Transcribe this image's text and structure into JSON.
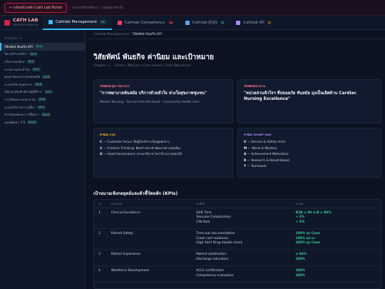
{
  "topbar": {
    "back_label": "← กลับหน้าหลัก Cath Lab Portal",
    "note": "ระบบบริหารจัดการ · แผนกสวนหัวใจ"
  },
  "sidebar": {
    "brand_title": "CATH LAB",
    "brand_sub": "บริหารจัดการคุณภาพ",
    "section_label": "หัวข้อจัดการ",
    "items": [
      {
        "label": "วิสัยทัศน์ พันธกิจ KPI",
        "badge": "Ch.1"
      },
      {
        "label": "โครงสร้างองค์กร",
        "badge": "Ch.2"
      },
      {
        "label": "นโยบายองค์กร",
        "badge": "Ch.3"
      },
      {
        "label": "ระบบงานประจำวัน",
        "badge": "Ch.4"
      },
      {
        "label": "คุณภาพและความปลอดภัย",
        "badge": "Ch.5"
      },
      {
        "label": "ระบบบริหารบุคลากร",
        "badge": "Ch.6"
      },
      {
        "label": "วัสดุ ครุภัณฑ์ ห้องปฏิบัติการ",
        "badge": "Ch.7"
      },
      {
        "label": "การเงินและงบประมาณ",
        "badge": "Ch.8"
      },
      {
        "label": "ระบบบริหารความเสี่ยง",
        "badge": "Ch.9"
      },
      {
        "label": "สารสนเทศและการสื่อสาร",
        "badge": "Ch.10"
      },
      {
        "label": "แผนพัฒนา 3 ปี",
        "badge": "Ch.11"
      }
    ]
  },
  "tabs": [
    {
      "label": "Cathlab Management",
      "badge": "11",
      "icon": "clipboard-icon",
      "color": "#38bdf8"
    },
    {
      "label": "Cathlab Competency",
      "badge": "18",
      "icon": "target-icon",
      "color": "#f43f5e"
    },
    {
      "label": "Cathlab JD/JS",
      "badge": "4",
      "icon": "person-icon",
      "color": "#60a5fa"
    },
    {
      "label": "Cathlab WI",
      "badge": "8",
      "icon": "gear-icon",
      "color": "#a78bfa"
    }
  ],
  "breadcrumb": {
    "root": "Cathlab Management /",
    "current": "วิสัยทัศน์ พันธกิจ KPI"
  },
  "page": {
    "title": "วิสัยทัศน์ พันธกิจ ค่านิยม และเป้าหมาย",
    "subtitle": "Chapter 1 — Vision | Mission | Core Values | Unit Objectives"
  },
  "vision_card": {
    "label": "วิสัยทัศน์กลุ่มการพยาบาล",
    "quote": "\"การพยาบาลทันสมัย บริการด้วยหัวใจ ห่วงใยสุขภาพชุมชน\"",
    "desc": "Modern Nursing · Service from the Heart · Community Health Care"
  },
  "unit_vision_card": {
    "label": "วิสัยทัศน์หน่วยงาน",
    "quote": "\"หน่วยสวนหัวใจฯ ที่ปลอดภัย ทันสมัย มุ่งเป็นเลิศด้าน Cardiac Nursing Excellence\""
  },
  "values_card": {
    "label": "ค่านิยม C2G",
    "lines": [
      {
        "key": "C",
        "text": "— Customer Focus: ยึดผู้รับบริการเป็นศูนย์กลาง"
      },
      {
        "key": "2",
        "text": "— Creative Thinking: คิดสร้างสรรค์ พัฒนาอย่างต่อเนื่อง"
      },
      {
        "key": "G",
        "text": "— Good Governance: ธรรมาภิบาล โปร่งใส ตรวจสอบได้"
      }
    ]
  },
  "smart_card": {
    "label": "ค่านิยม SMART RAO",
    "lines": [
      {
        "key": "S",
        "text": "— Service & Safety mind"
      },
      {
        "key": "M",
        "text": "— Moral & Mastery"
      },
      {
        "key": "A",
        "text": "— Achievement Motivation"
      },
      {
        "key": "R",
        "text": "— Research & Result-based"
      },
      {
        "key": "T",
        "text": "— Teamwork"
      }
    ]
  },
  "kpi": {
    "title": "เป้าหมายเชิงกลยุทธ์และตัวชี้วัดหลัก (KPIs)",
    "headers": [
      "#",
      "เป้าหมาย",
      "ตัวชี้วัด",
      "เกณฑ์"
    ],
    "rows": [
      {
        "no": "1",
        "goal": "Clinical Excellence",
        "indicators": [
          "D2B Time",
          "Vascular Complication",
          "CIN Rate"
        ],
        "targets": [
          "D2B ≤ 90 นาที ≥ 90%",
          "< 3%",
          "< 5%"
        ]
      },
      {
        "no": "2",
        "goal": "Patient Safety",
        "indicators": [
          "Time-out documentation",
          "Crash cart readiness",
          "High Alert Drug double check"
        ],
        "targets": [
          "100% ทุก Case",
          "100% ทุกเวร",
          "100% ทุก Case"
        ]
      },
      {
        "no": "3",
        "goal": "Patient Experience",
        "indicators": [
          "Patient satisfaction",
          "Discharge education"
        ],
        "targets": [
          "≥ 86%",
          "100%"
        ]
      },
      {
        "no": "4",
        "goal": "Workforce Development",
        "indicators": [
          "ACLS certification",
          "Competency evaluation"
        ],
        "targets": [
          "100%",
          "100%"
        ]
      }
    ]
  }
}
